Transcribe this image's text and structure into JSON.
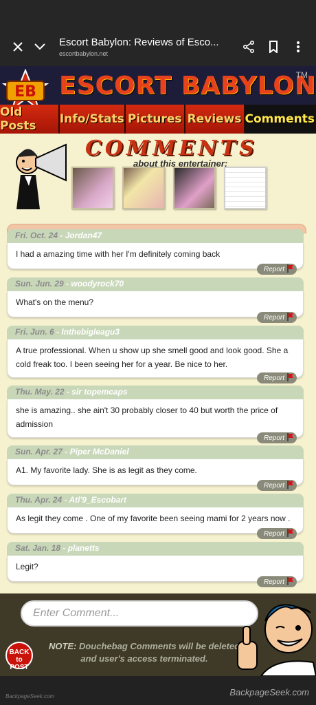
{
  "browser": {
    "title": "Escort Babylon: Reviews of Esco...",
    "url": "escortbabylon.net"
  },
  "site": {
    "logo_badge": "EB",
    "logo_text": "ESCORT BABYLON",
    "trademark": "TM"
  },
  "nav": [
    "Old Posts",
    "Info/Stats",
    "Pictures",
    "Reviews",
    "Comments"
  ],
  "hero": {
    "title": "COMMENTS",
    "subtitle": "about this entertainer:"
  },
  "comments": [
    {
      "date": "Fri. Oct. 24",
      "user": "Jordan47",
      "text": "I had a amazing time with her I'm definitely coming back",
      "report": "Report"
    },
    {
      "date": "Sun. Jun. 29",
      "user": "woodyrock70",
      "text": "What's on the menu?",
      "report": "Report"
    },
    {
      "date": "Fri. Jun. 6",
      "user": "Inthebigleagu3",
      "text": "A true professional. When u show up she smell good and look good. She a cold freak too. I been seeing her for a year. Be nice to her.",
      "report": "Report"
    },
    {
      "date": "Thu. May. 22",
      "user": "sir topemcaps",
      "text": "she is amazing.. she ain't 30 probably closer to 40 but worth the price of admission",
      "report": "Report"
    },
    {
      "date": "Sun. Apr. 27",
      "user": "Piper McDaniel",
      "text": "A1. My favorite lady. She is as legit as they come.",
      "report": "Report"
    },
    {
      "date": "Thu. Apr. 24",
      "user": "Atl'9_Escobart",
      "text": "As legit they come . One of my favorite been seeing mami for 2 years now .",
      "report": "Report"
    },
    {
      "date": "Sat. Jan. 18",
      "user": "planetts",
      "text": "Legit?",
      "report": "Report"
    }
  ],
  "footer": {
    "input_placeholder": "Enter Comment...",
    "back_label": "BACK to POST",
    "note_label": "NOTE:",
    "note_text": "Douchebag Comments will be deleted and user's access terminated."
  },
  "watermarks": {
    "left": "BackpageSeek.com",
    "right": "BackpageSeek.com"
  }
}
